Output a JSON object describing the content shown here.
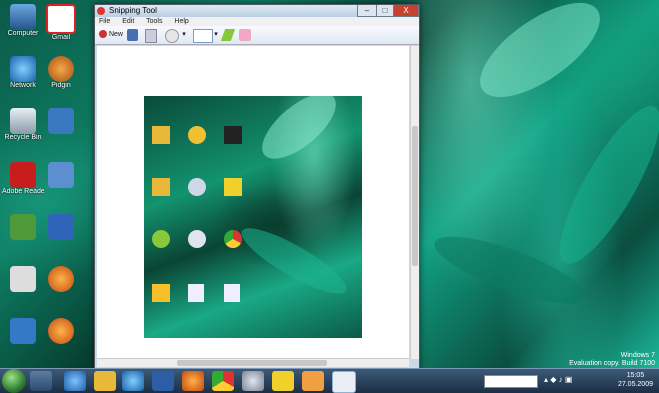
{
  "window": {
    "title": "Snipping Tool",
    "minimize_glyph": "–",
    "maximize_glyph": "□",
    "close_glyph": "X"
  },
  "menu": {
    "file": "File",
    "edit": "Edit",
    "tools": "Tools",
    "help": "Help"
  },
  "toolbar": {
    "new_label": "New"
  },
  "desktop_icons": [
    "Computer",
    "Gmail",
    "Network",
    "Pidgin",
    "Recycle Bin",
    "Adobe Reader"
  ],
  "taskbar": {
    "clock_time": "15:05",
    "clock_date": "27.05.2009"
  },
  "watermark": {
    "line1": "Windows 7",
    "line2": "Evaluation copy. Build 7100"
  },
  "colors": {
    "accent": "#12a184",
    "taskbar": "#1b2e44"
  }
}
